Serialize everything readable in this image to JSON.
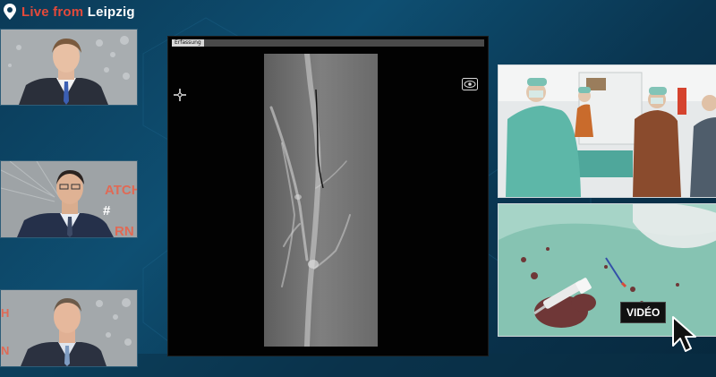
{
  "header": {
    "live_prefix": "Live from",
    "city": "Leipzig",
    "pin_icon": "location-pin-icon",
    "accent_color": "#e34a3b"
  },
  "speakers": [
    {
      "name": "speaker-1"
    },
    {
      "name": "speaker-2",
      "backdrop_text_1": "ATCH",
      "backdrop_text_2": "#",
      "backdrop_text_3": "RN"
    },
    {
      "name": "speaker-3",
      "backdrop_text_1": "H",
      "backdrop_text_2": "N"
    }
  ],
  "monitor": {
    "tab_label": "Erfassung",
    "icons": [
      "crosshair-icon",
      "eye-icon"
    ]
  },
  "video": {
    "badge_label": "VIDÉO",
    "cursor_icon": "pointer-cursor-icon"
  }
}
